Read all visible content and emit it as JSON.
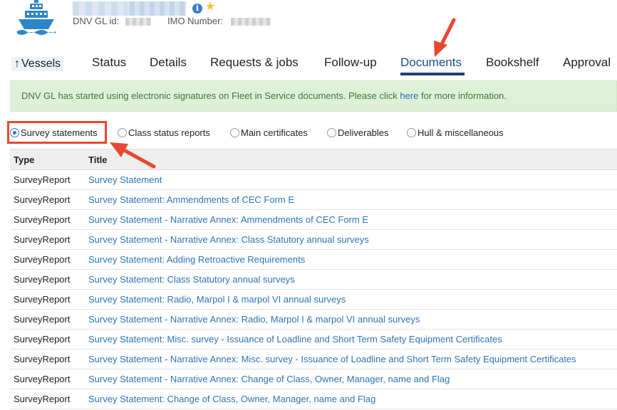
{
  "header": {
    "dnv_id_label": "DNV GL id:",
    "imo_label": "IMO Number:"
  },
  "nav": {
    "back_label": "Vessels",
    "tabs": [
      {
        "label": "Status"
      },
      {
        "label": "Details"
      },
      {
        "label": "Requests & jobs"
      },
      {
        "label": "Follow-up"
      },
      {
        "label": "Documents",
        "active": true
      },
      {
        "label": "Bookshelf"
      },
      {
        "label": "Approval"
      }
    ]
  },
  "notice": {
    "text_before": "DNV GL has started using electronic signatures on Fleet in Service documents. Please click ",
    "link": "here",
    "text_after": " for more information."
  },
  "filters": {
    "selected": "Survey statements",
    "options": [
      "Survey statements",
      "Class status reports",
      "Main certificates",
      "Deliverables",
      "Hull & miscellaneous"
    ]
  },
  "table": {
    "headers": [
      "Type",
      "Title"
    ],
    "rows": [
      {
        "type": "SurveyReport",
        "title": "Survey Statement"
      },
      {
        "type": "SurveyReport",
        "title": "Survey Statement: Ammendments of CEC Form E"
      },
      {
        "type": "SurveyReport",
        "title": "Survey Statement - Narrative Annex: Ammendments of CEC Form E"
      },
      {
        "type": "SurveyReport",
        "title": "Survey Statement - Narrative Annex: Class Statutory annual surveys"
      },
      {
        "type": "SurveyReport",
        "title": "Survey Statement: Adding Retroactive Requirements"
      },
      {
        "type": "SurveyReport",
        "title": "Survey Statement: Class Statutory annual surveys"
      },
      {
        "type": "SurveyReport",
        "title": "Survey Statement: Radio, Marpol I & marpol VI annual surveys"
      },
      {
        "type": "SurveyReport",
        "title": "Survey Statement - Narrative Annex: Radio, Marpol I & marpol VI annual surveys"
      },
      {
        "type": "SurveyReport",
        "title": "Survey Statement: Misc. survey - Issuance of Loadline and Short Term Safety Equipment Certificates"
      },
      {
        "type": "SurveyReport",
        "title": "Survey Statement - Narrative Annex: Misc. survey - Issuance of Loadline and Short Term Safety Equipment Certificates"
      },
      {
        "type": "SurveyReport",
        "title": "Survey Statement - Narrative Annex: Change of Class, Owner, Manager, name and Flag"
      },
      {
        "type": "SurveyReport",
        "title": "Survey Statement: Change of Class, Owner, Manager, name and Flag"
      }
    ]
  },
  "colors": {
    "link": "#2e74b8",
    "annotation": "#e8472f",
    "notice_bg": "#dff0d8",
    "active_tab_underline": "#1f3f7a"
  }
}
